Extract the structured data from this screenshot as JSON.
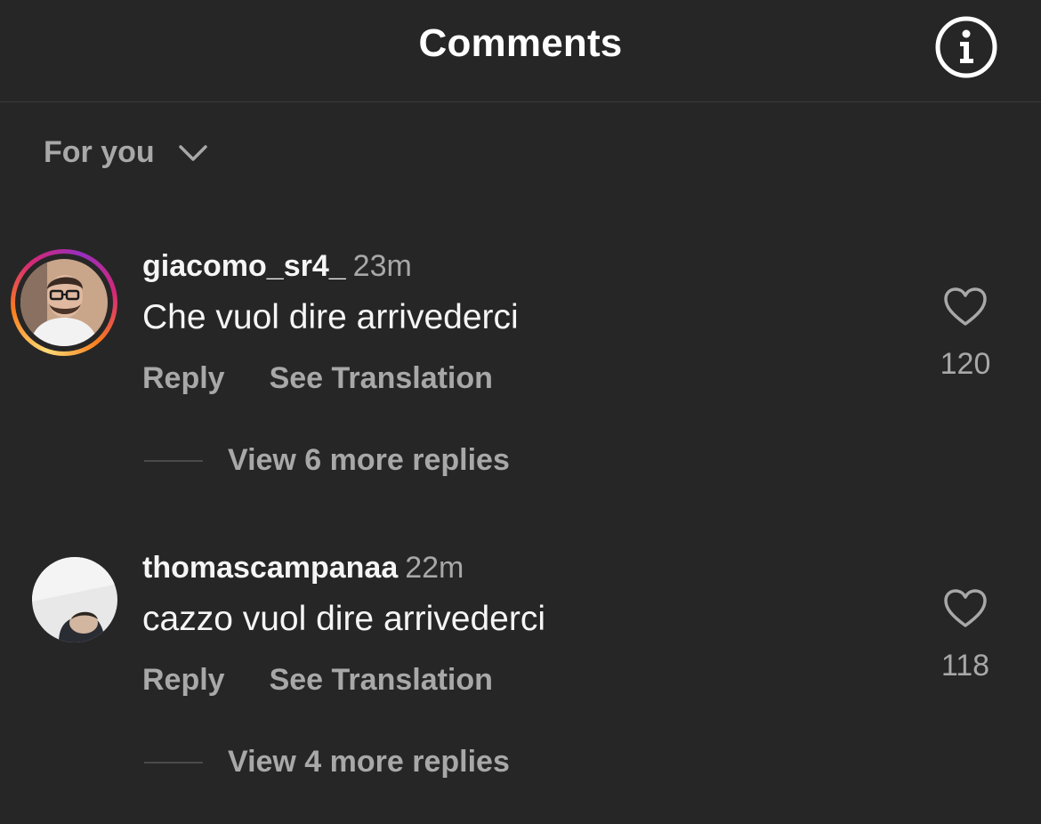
{
  "header": {
    "title": "Comments",
    "info_icon": "info-icon"
  },
  "filter": {
    "label": "For you",
    "icon": "chevron-down-icon"
  },
  "comments": [
    {
      "username": "giacomo_sr4_",
      "time": "23m",
      "text": "Che vuol dire arrivederci",
      "reply_label": "Reply",
      "translate_label": "See Translation",
      "likes": "120",
      "view_replies": "View 6 more replies",
      "has_story_ring": true
    },
    {
      "username": "thomascampanaa",
      "time": "22m",
      "text": "cazzo vuol dire arrivederci",
      "reply_label": "Reply",
      "translate_label": "See Translation",
      "likes": "118",
      "view_replies": "View 4 more replies",
      "has_story_ring": false
    }
  ],
  "colors": {
    "background": "#262626",
    "primary_text": "#f5f5f5",
    "secondary_text": "#a8a8a8"
  }
}
